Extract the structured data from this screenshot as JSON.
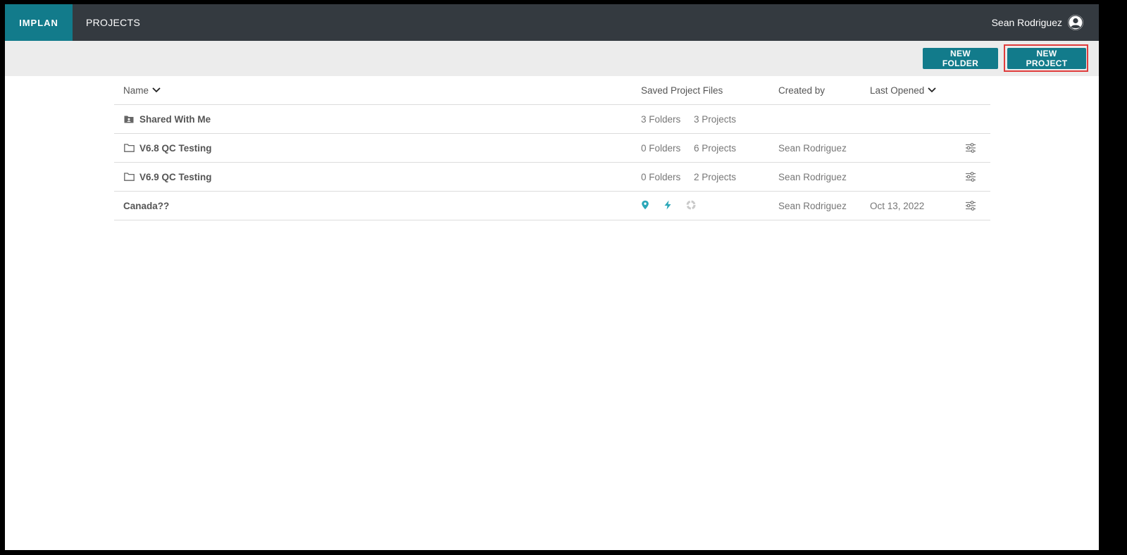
{
  "app": {
    "logo": "IMPLAN",
    "nav_projects": "PROJECTS",
    "user_name": "Sean Rodriguez"
  },
  "toolbar": {
    "new_folder_label": "NEW FOLDER",
    "new_project_label": "NEW PROJECT"
  },
  "table": {
    "headers": {
      "name": "Name",
      "saved_files": "Saved Project Files",
      "created_by": "Created by",
      "last_opened": "Last Opened"
    },
    "rows": [
      {
        "name": "Shared With Me",
        "folders": "3 Folders",
        "projects": "3 Projects",
        "created_by": "",
        "last_opened": "",
        "icon": "shared-folder-icon"
      },
      {
        "name": "V6.8 QC Testing",
        "folders": "0 Folders",
        "projects": "6 Projects",
        "created_by": "Sean Rodriguez",
        "last_opened": "",
        "icon": "folder-icon"
      },
      {
        "name": "V6.9 QC Testing",
        "folders": "0 Folders",
        "projects": "2 Projects",
        "created_by": "Sean Rodriguez",
        "last_opened": "",
        "icon": "folder-icon"
      },
      {
        "name": "Canada??",
        "folders": "",
        "projects": "",
        "created_by": "Sean Rodriguez",
        "last_opened": "Oct 13, 2022",
        "icon": ""
      }
    ]
  },
  "colors": {
    "brand": "#127b8b",
    "topbar": "#343a40",
    "toolbar": "#ececec",
    "highlight": "#e03c3c",
    "status_icon": "#2aa7b8"
  }
}
